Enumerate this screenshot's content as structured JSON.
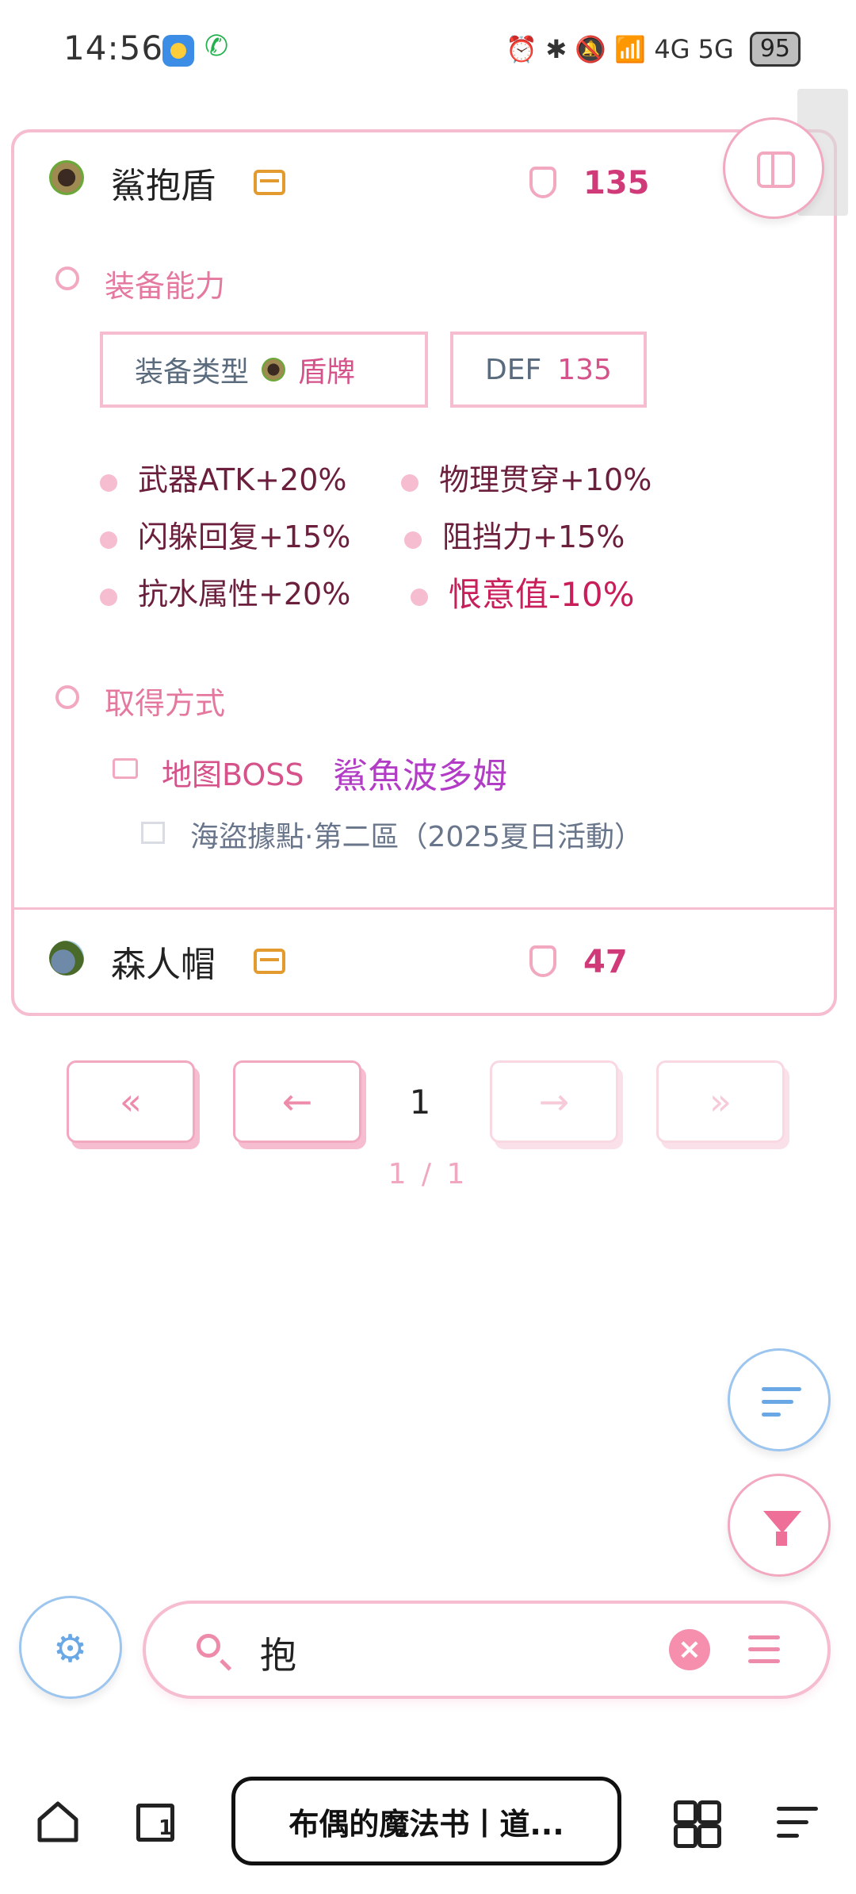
{
  "status_bar": {
    "time": "14:56",
    "network_icons": "⏰ ✱ 🔕 📶 4G 5G",
    "battery": "95"
  },
  "items": [
    {
      "name": "鯊抱盾",
      "def": "135",
      "ability_title": "装备能力",
      "type_label": "装备类型",
      "type_value": "盾牌",
      "def_label": "DEF",
      "def_value": "135",
      "stats": [
        "武器ATK+20%",
        "物理贯穿+10%",
        "闪躲回复+15%",
        "阻挡力+15%",
        "抗水属性+20%",
        "恨意值-10%"
      ],
      "obtain_title": "取得方式",
      "obtain_label": "地图BOSS",
      "boss": "鯊魚波多姆",
      "location": "海盜據點·第二區（2025夏日活動）"
    },
    {
      "name": "森人帽",
      "def": "47"
    }
  ],
  "pagination": {
    "first": "«",
    "prev": "←",
    "current": "1",
    "next": "→",
    "last": "»",
    "total": "1 / 1"
  },
  "search": {
    "value": "抱",
    "clear": "×"
  },
  "browser": {
    "tab_count": "1",
    "page_title": "布偶的魔法书丨道..."
  },
  "colors": {
    "accent_pink": "#f2a9c0",
    "accent_blue": "#6aa8e5",
    "def_color": "#d13a79"
  }
}
